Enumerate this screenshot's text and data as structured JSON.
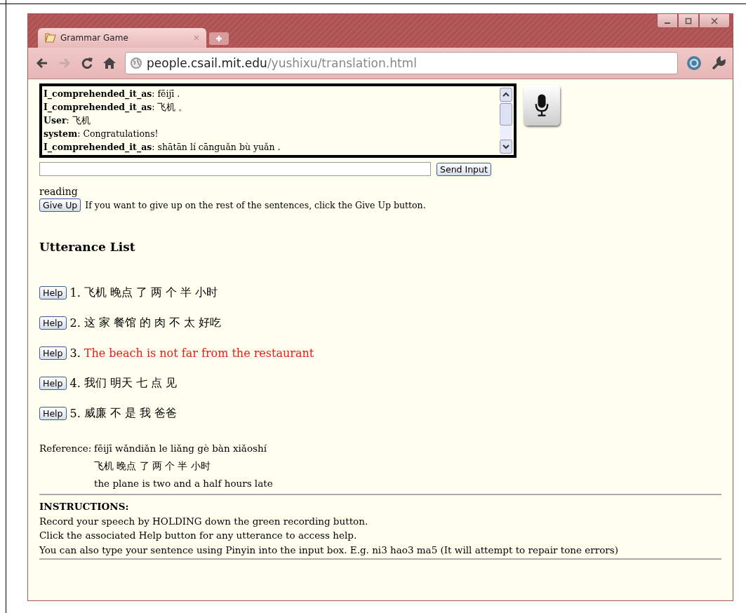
{
  "window": {
    "tab_title": "Grammar Game",
    "url_host": "people.csail.mit.edu",
    "url_path": "/yushixu/translation.html"
  },
  "chat_log": [
    "**I_comprehended_it_as**: fēijī .",
    "**I_comprehended_it_as**: 飞机 。",
    "**User**: 飞机",
    "**system**: Congratulations!",
    "**I_comprehended_it_as**: shātān lí cānguǎn bù yuǎn ."
  ],
  "send_button": "Send Input",
  "status": "reading",
  "give_up_button": "Give Up",
  "give_up_hint": "If you want to give up on the rest of the sentences, click the Give Up button.",
  "utterance_heading": "Utterance List",
  "utterances": [
    {
      "button": "Help",
      "number": "1.",
      "text": "飞机 晚点 了 两 个 半 小时",
      "current": false
    },
    {
      "button": "Help",
      "number": "2.",
      "text": "这 家 餐馆 的 肉 不 太 好吃",
      "current": false
    },
    {
      "button": "Help",
      "number": "3.",
      "text": "The beach is not far from the restaurant",
      "current": true
    },
    {
      "button": "Help",
      "number": "4.",
      "text": "我们 明天 七 点 见",
      "current": false
    },
    {
      "button": "Help",
      "number": "5.",
      "text": "威廉 不 是 我 爸爸",
      "current": false
    }
  ],
  "reference": {
    "label": "Reference:",
    "pinyin": "fēijī wǎndiǎn le liǎng gè bàn xiǎoshí",
    "hanzi": "飞机 晚点 了 两 个 半 小时",
    "english": "the plane is two and a half hours late"
  },
  "instructions": {
    "heading": "INSTRUCTIONS:",
    "lines": [
      "Record your speech by HOLDING down the green recording button.",
      "Click the associated Help button for any utterance to access help.",
      "You can also type your sentence using Pinyin into the input box. E.g. ni3 hao3 ma5 (It will attempt to repair tone errors)"
    ]
  }
}
